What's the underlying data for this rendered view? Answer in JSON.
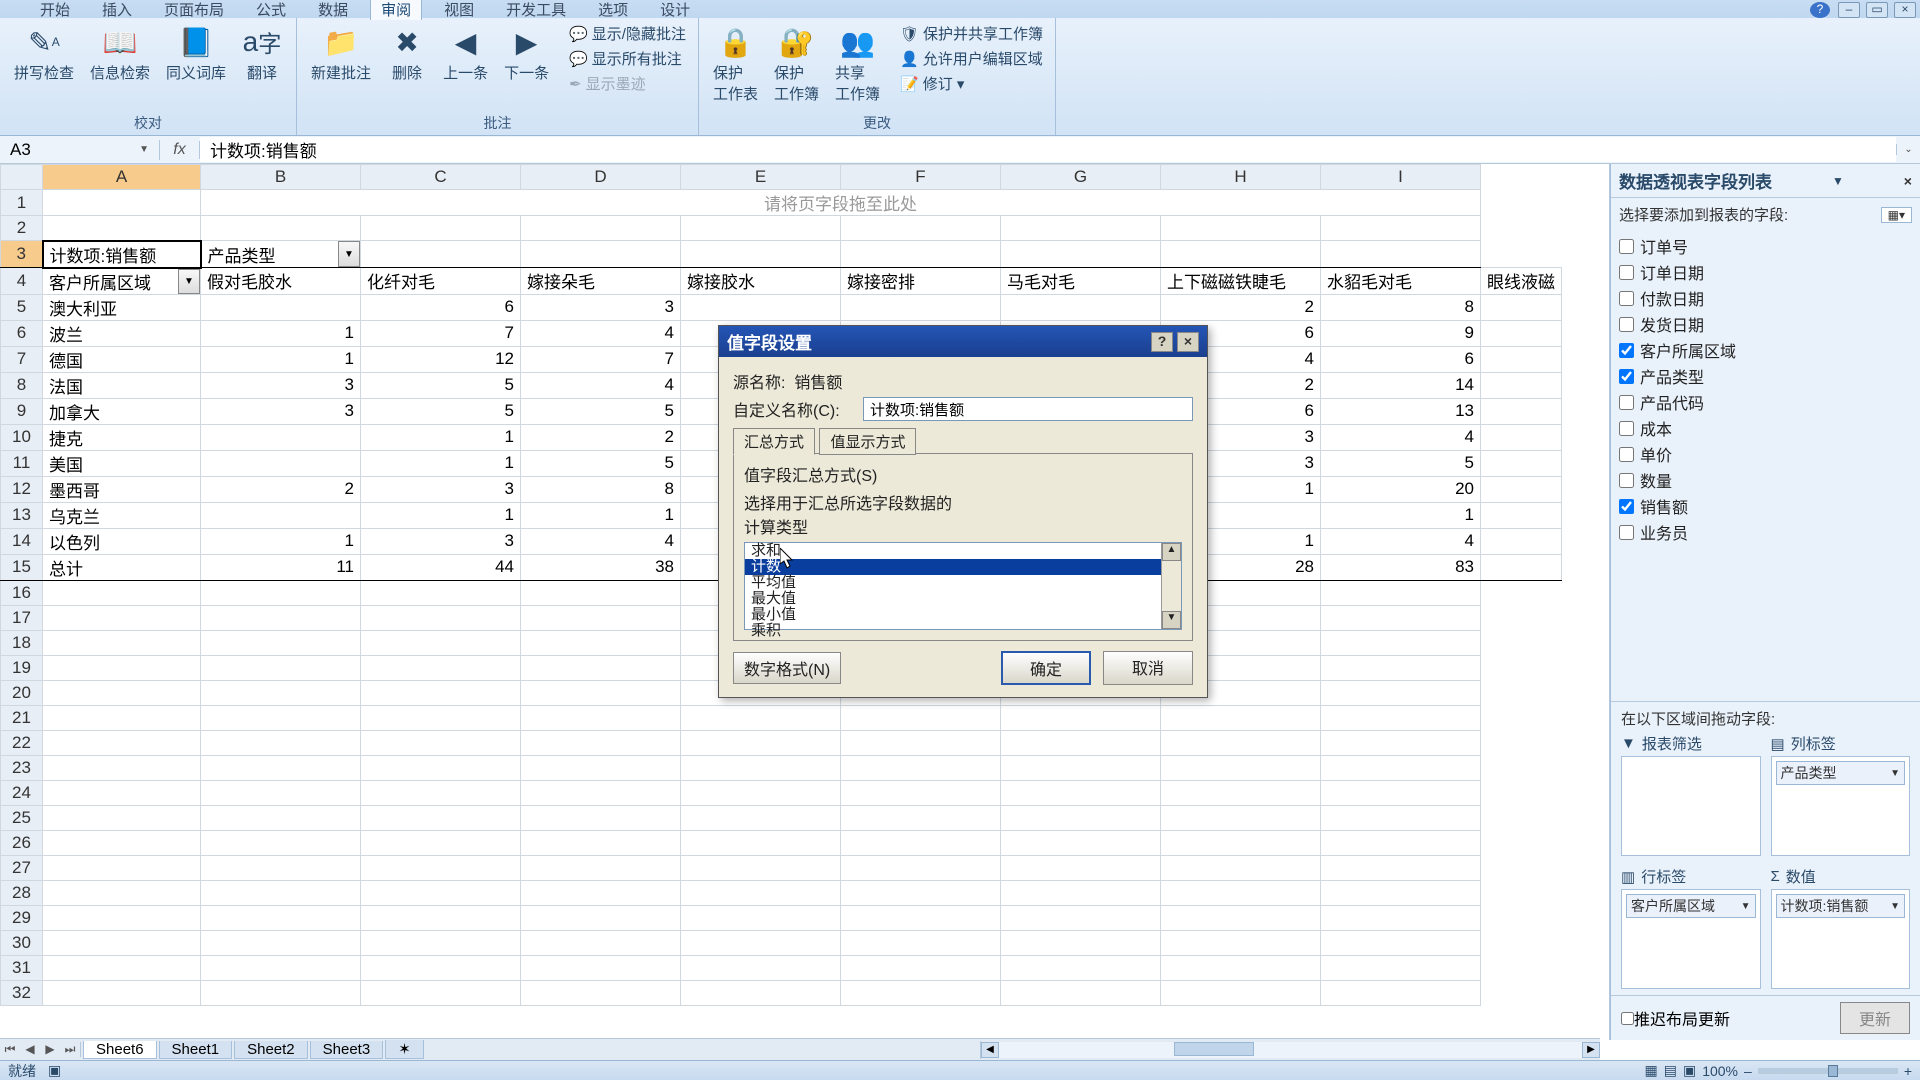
{
  "menubar": {
    "items": [
      "开始",
      "插入",
      "页面布局",
      "公式",
      "数据",
      "审阅",
      "视图",
      "开发工具",
      "选项",
      "设计"
    ],
    "active_index": 5
  },
  "ribbon": {
    "groups": [
      {
        "title": "校对",
        "buttons": [
          {
            "icon": "✎",
            "label": "拼写检查"
          },
          {
            "icon": "📖",
            "label": "信息检索"
          },
          {
            "icon": "📘",
            "label": "同义词库"
          },
          {
            "icon": "🈂",
            "label": "翻译"
          }
        ]
      },
      {
        "title": "批注",
        "buttons": [
          {
            "icon": "📂",
            "label": "新建批注"
          },
          {
            "icon": "✖",
            "label": "删除"
          },
          {
            "icon": "◀",
            "label": "上一条"
          },
          {
            "icon": "▶",
            "label": "下一条"
          }
        ],
        "side": [
          "显示/隐藏批注",
          "显示所有批注",
          "显示墨迹"
        ]
      },
      {
        "title": "更改",
        "buttons": [
          {
            "icon": "🔒",
            "label": "保护\n工作表"
          },
          {
            "icon": "🔐",
            "label": "保护\n工作簿"
          },
          {
            "icon": "👥",
            "label": "共享\n工作簿"
          }
        ],
        "side": [
          "保护并共享工作簿",
          "允许用户编辑区域",
          "修订 ▾"
        ]
      }
    ]
  },
  "fbar": {
    "name": "A3",
    "fx": "fx",
    "formula": "计数项:销售额"
  },
  "grid": {
    "cols": [
      "A",
      "B",
      "C",
      "D",
      "E",
      "F",
      "G",
      "H",
      "I"
    ],
    "placeholder": "请将页字段拖至此处",
    "row3": [
      "计数项:销售额",
      "产品类型"
    ],
    "row4": [
      "客户所属区域",
      "假对毛胶水",
      "化纤对毛",
      "嫁接朵毛",
      "嫁接胶水",
      "嫁接密排",
      "马毛对毛",
      "上下磁磁铁睫毛",
      "水貂毛对毛",
      "眼线液磁"
    ],
    "rows": [
      {
        "n": 5,
        "label": "澳大利亚",
        "v": [
          "",
          "6",
          "3",
          "",
          "",
          "",
          "2",
          "8",
          ""
        ]
      },
      {
        "n": 6,
        "label": "波兰",
        "v": [
          "1",
          "7",
          "4",
          "",
          "",
          "",
          "6",
          "9",
          ""
        ]
      },
      {
        "n": 7,
        "label": "德国",
        "v": [
          "1",
          "12",
          "7",
          "",
          "",
          "",
          "4",
          "6",
          ""
        ]
      },
      {
        "n": 8,
        "label": "法国",
        "v": [
          "3",
          "5",
          "4",
          "",
          "",
          "",
          "2",
          "14",
          ""
        ]
      },
      {
        "n": 9,
        "label": "加拿大",
        "v": [
          "3",
          "5",
          "5",
          "",
          "",
          "",
          "6",
          "13",
          ""
        ]
      },
      {
        "n": 10,
        "label": "捷克",
        "v": [
          "",
          "1",
          "2",
          "",
          "",
          "",
          "3",
          "4",
          ""
        ]
      },
      {
        "n": 11,
        "label": "美国",
        "v": [
          "",
          "1",
          "5",
          "",
          "",
          "",
          "3",
          "5",
          ""
        ]
      },
      {
        "n": 12,
        "label": "墨西哥",
        "v": [
          "2",
          "3",
          "8",
          "",
          "",
          "",
          "1",
          "20",
          ""
        ]
      },
      {
        "n": 13,
        "label": "乌克兰",
        "v": [
          "",
          "1",
          "1",
          "",
          "",
          "",
          "",
          "1",
          ""
        ]
      },
      {
        "n": 14,
        "label": "以色列",
        "v": [
          "1",
          "3",
          "4",
          "",
          "",
          "",
          "1",
          "4",
          ""
        ]
      }
    ],
    "total": {
      "n": 15,
      "label": "总计",
      "v": [
        "11",
        "44",
        "38",
        "",
        "",
        "",
        "28",
        "83",
        ""
      ]
    }
  },
  "dialog": {
    "title": "值字段设置",
    "source_label": "源名称:",
    "source_value": "销售额",
    "custom_label": "自定义名称(C):",
    "custom_value": "计数项:销售额",
    "tabs": [
      "汇总方式",
      "值显示方式"
    ],
    "panel_label": "值字段汇总方式(S)",
    "panel_desc": "选择用于汇总所选字段数据的",
    "panel_calc": "计算类型",
    "options": [
      "求和",
      "计数",
      "平均值",
      "最大值",
      "最小值",
      "乘积"
    ],
    "selected_index": 1,
    "number_format": "数字格式(N)",
    "ok": "确定",
    "cancel": "取消"
  },
  "sidepane": {
    "title": "数据透视表字段列表",
    "subtitle": "选择要添加到报表的字段:",
    "fields": [
      {
        "label": "订单号",
        "checked": false
      },
      {
        "label": "订单日期",
        "checked": false
      },
      {
        "label": "付款日期",
        "checked": false
      },
      {
        "label": "发货日期",
        "checked": false
      },
      {
        "label": "客户所属区域",
        "checked": true
      },
      {
        "label": "产品类型",
        "checked": true
      },
      {
        "label": "产品代码",
        "checked": false
      },
      {
        "label": "成本",
        "checked": false
      },
      {
        "label": "单价",
        "checked": false
      },
      {
        "label": "数量",
        "checked": false
      },
      {
        "label": "销售额",
        "checked": true
      },
      {
        "label": "业务员",
        "checked": false
      }
    ],
    "areas_label": "在以下区域间拖动字段:",
    "areas": {
      "filter": {
        "title": "报表筛选",
        "items": []
      },
      "cols": {
        "title": "列标签",
        "items": [
          "产品类型"
        ]
      },
      "rows": {
        "title": "行标签",
        "items": [
          "客户所属区域"
        ]
      },
      "vals": {
        "title": "数值",
        "items": [
          "计数项:销售额"
        ]
      }
    },
    "defer": "推迟布局更新",
    "update": "更新"
  },
  "sheettabs": {
    "tabs": [
      "Sheet6",
      "Sheet1",
      "Sheet2",
      "Sheet3"
    ],
    "active": 0
  },
  "status": {
    "left": "就绪",
    "zoom": "100%"
  }
}
